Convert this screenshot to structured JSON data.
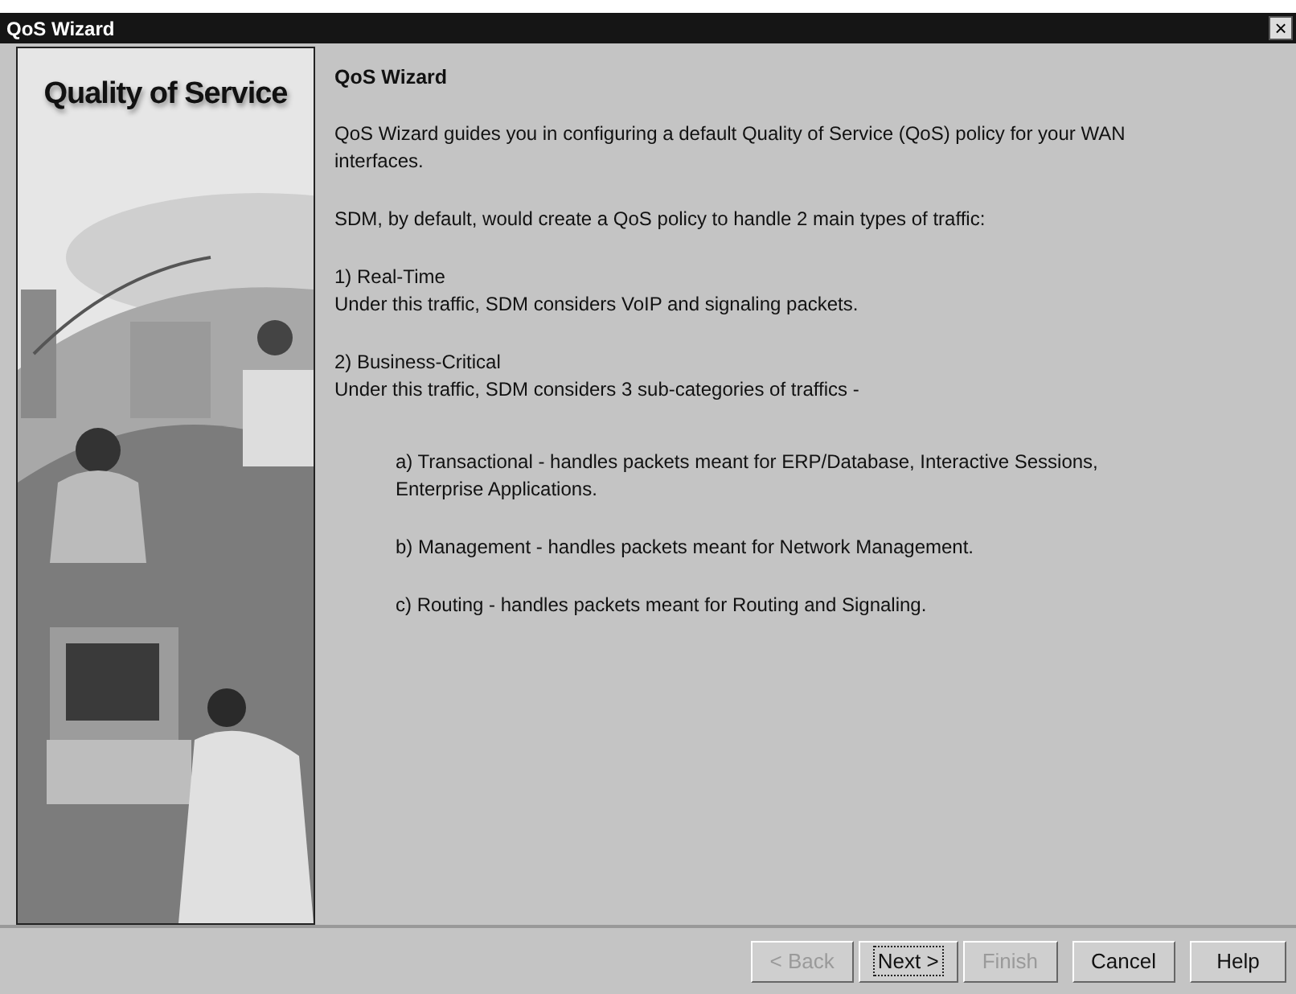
{
  "window": {
    "title": "QoS Wizard",
    "close": "×"
  },
  "banner": {
    "title": "Quality of Service",
    "kind": "picture"
  },
  "heading": "QoS Wizard",
  "paragraphs": [
    {
      "kind": "paragraph",
      "lines": [
        "QoS Wizard guides you in configuring a default Quality of Service (QoS) policy for your WAN interfaces."
      ]
    },
    {
      "kind": "paragraph",
      "lines": [
        "SDM, by default, would create a QoS policy to handle 2 main types of traffic:"
      ]
    },
    {
      "kind": "paragraph",
      "lines": [
        "1) Real-Time",
        "Under this traffic, SDM considers VoIP and signaling packets."
      ]
    },
    {
      "kind": "paragraph",
      "lines": [
        "2) Business-Critical",
        "Under this traffic, SDM considers 3 sub-categories of traffics -"
      ]
    },
    {
      "kind": "subitem",
      "lines": [
        "a) Transactional - handles packets meant for ERP/Database, Interactive Sessions, Enterprise Applications."
      ]
    },
    {
      "kind": "subitem",
      "lines": [
        "b) Management - handles packets meant for Network Management."
      ]
    },
    {
      "kind": "subitem",
      "lines": [
        "c) Routing - handles packets meant for Routing and Signaling."
      ]
    }
  ],
  "buttons": [
    {
      "label": "< Back",
      "disabled": true,
      "focused": false
    },
    {
      "label": "Next >",
      "disabled": false,
      "focused": true
    },
    {
      "label": "Finish",
      "disabled": true,
      "focused": false
    },
    {
      "label": "Cancel",
      "disabled": false,
      "focused": false
    },
    {
      "label": "Help",
      "disabled": false,
      "focused": false
    }
  ]
}
